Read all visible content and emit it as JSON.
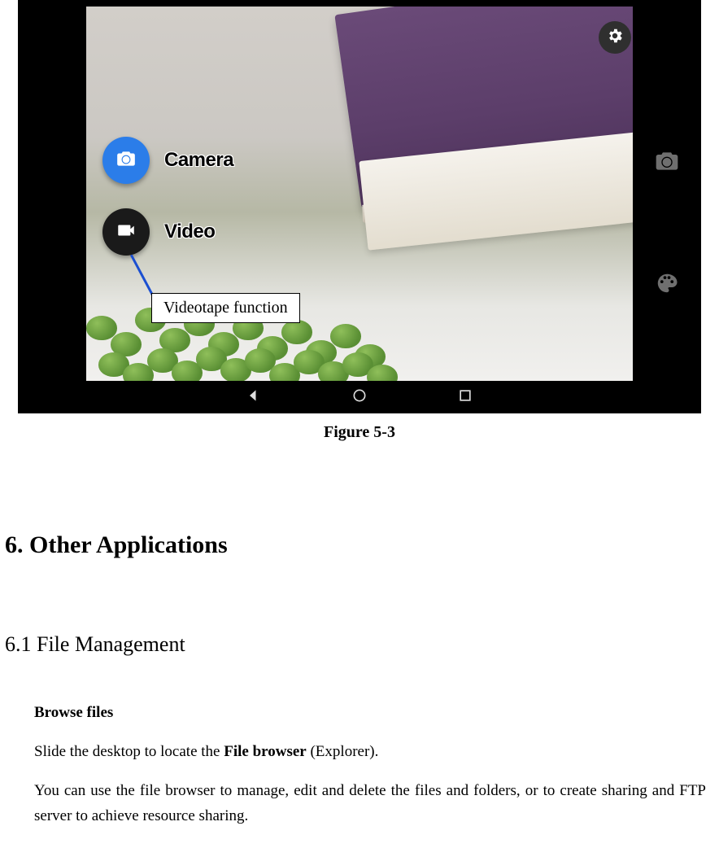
{
  "screenshot": {
    "settings_icon": "gear-icon",
    "options": {
      "camera_label": "Camera",
      "video_label": "Video"
    },
    "callout_text": "Videotape function",
    "side_icons": [
      "camera-icon",
      "palette-icon"
    ],
    "nav_icons": [
      "back-icon",
      "home-icon",
      "recent-icon"
    ]
  },
  "figure_caption": "Figure 5-3",
  "section_heading": "6. Other Applications",
  "subsection_heading": "6.1 File Management",
  "browse_heading": "Browse files",
  "para1_a": "Slide the desktop to locate the ",
  "para1_b": "File browser",
  "para1_c": " (Explorer).",
  "para2": "You can use the file browser to manage, edit and delete the files and folders, or to create sharing and FTP server to achieve resource sharing."
}
